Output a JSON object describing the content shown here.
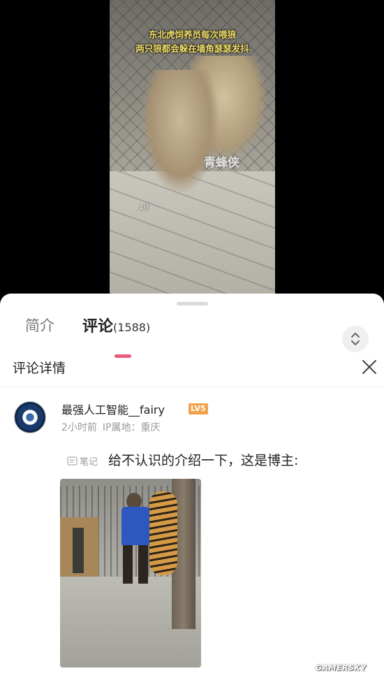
{
  "video": {
    "caption_line1": "东北虎饲养员每次喂狼",
    "caption_line2": "两只狼都会躲在墙角瑟瑟发抖",
    "watermark": "青蜂侠",
    "small_label": "4月"
  },
  "tabs": [
    {
      "label": "简介",
      "active": false
    },
    {
      "label": "评论",
      "count": "(1588)",
      "active": true
    }
  ],
  "detail": {
    "title": "评论详情"
  },
  "comment": {
    "username": "最强人工智能__fairy",
    "level": "LV5",
    "time": "2小时前",
    "ip_location": "IP属地：重庆",
    "note_label": "笔记",
    "text": "给不认识的介绍一下，这是博主:"
  },
  "site_watermark": "GAMERSKY",
  "colors": {
    "accent": "#ea5b7b",
    "badge": "#f0a24b",
    "caption": "#f3e06a"
  },
  "icons": {
    "collapse": "chevron-up-down-icon",
    "close": "close-icon",
    "note": "note-icon"
  }
}
